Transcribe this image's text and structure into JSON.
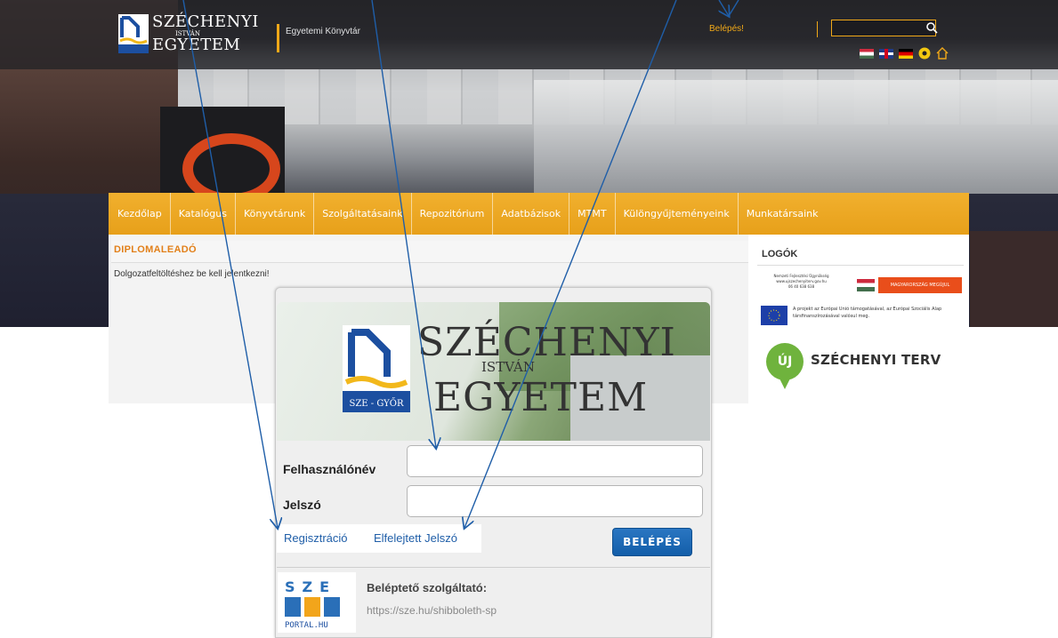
{
  "header": {
    "logo": {
      "line1": "SZÉCHENYI",
      "line2": "ISTVÁN",
      "line3": "EGYETEM",
      "badge": "SZE - GYŐR"
    },
    "site_name": "Egyetemi Könyvtár",
    "login_link": "Belépés!",
    "search": {
      "value": "",
      "icon": "search-icon"
    },
    "languages": [
      "hu",
      "en",
      "de"
    ],
    "icons": [
      "accessibility-icon",
      "home-icon"
    ],
    "accent_color": "#f0a818"
  },
  "nav": {
    "items": [
      "Kezdőlap",
      "Katalógus",
      "Könyvtárunk",
      "Szolgáltatásaink",
      "Repozitórium",
      "Adatbázisok",
      "MTMT",
      "Különgyűjteményeink",
      "Munkatársaink"
    ]
  },
  "main": {
    "title": "DIPLOMALEADÓ",
    "notice": "Dolgozatfeltöltéshez be kell jelentkezni!"
  },
  "sidebar": {
    "title": "LOGÓK",
    "banner1": {
      "agency_line1": "Nemzeti Fejlesztési Ügynökség",
      "agency_line2": "www.ujszechenyiterv.gov.hu",
      "agency_line3": "06 40 638 638",
      "hu_badge": "MAGYARORSZÁG MEGÚJUL",
      "eu_text": "A projekt az Európai Unió támogatásával, az Európai Szociális Alap társfinanszírozásával valósul meg."
    },
    "banner2": {
      "pin": "ÚJ",
      "text": "SZÉCHENYI TERV"
    }
  },
  "login": {
    "logo": {
      "line1": "SZÉCHENYI",
      "line2": "ISTVÁN",
      "line3": "EGYETEM",
      "badge": "SZE - GYŐR"
    },
    "username_label": "Felhasználónév",
    "username_value": "",
    "password_label": "Jelszó",
    "password_value": "",
    "register_link": "Regisztráció",
    "forgot_link": "Elfelejtett Jelszó",
    "submit_label": "BELÉPÉS",
    "provider_title": "Beléptető szolgáltató:",
    "provider_url": "https://sze.hu/shibboleth-sp",
    "provider_logo_text": "PORTAL.HU",
    "provider_logo_letters": "SZE"
  },
  "annotation_color": "#1f5ea8"
}
